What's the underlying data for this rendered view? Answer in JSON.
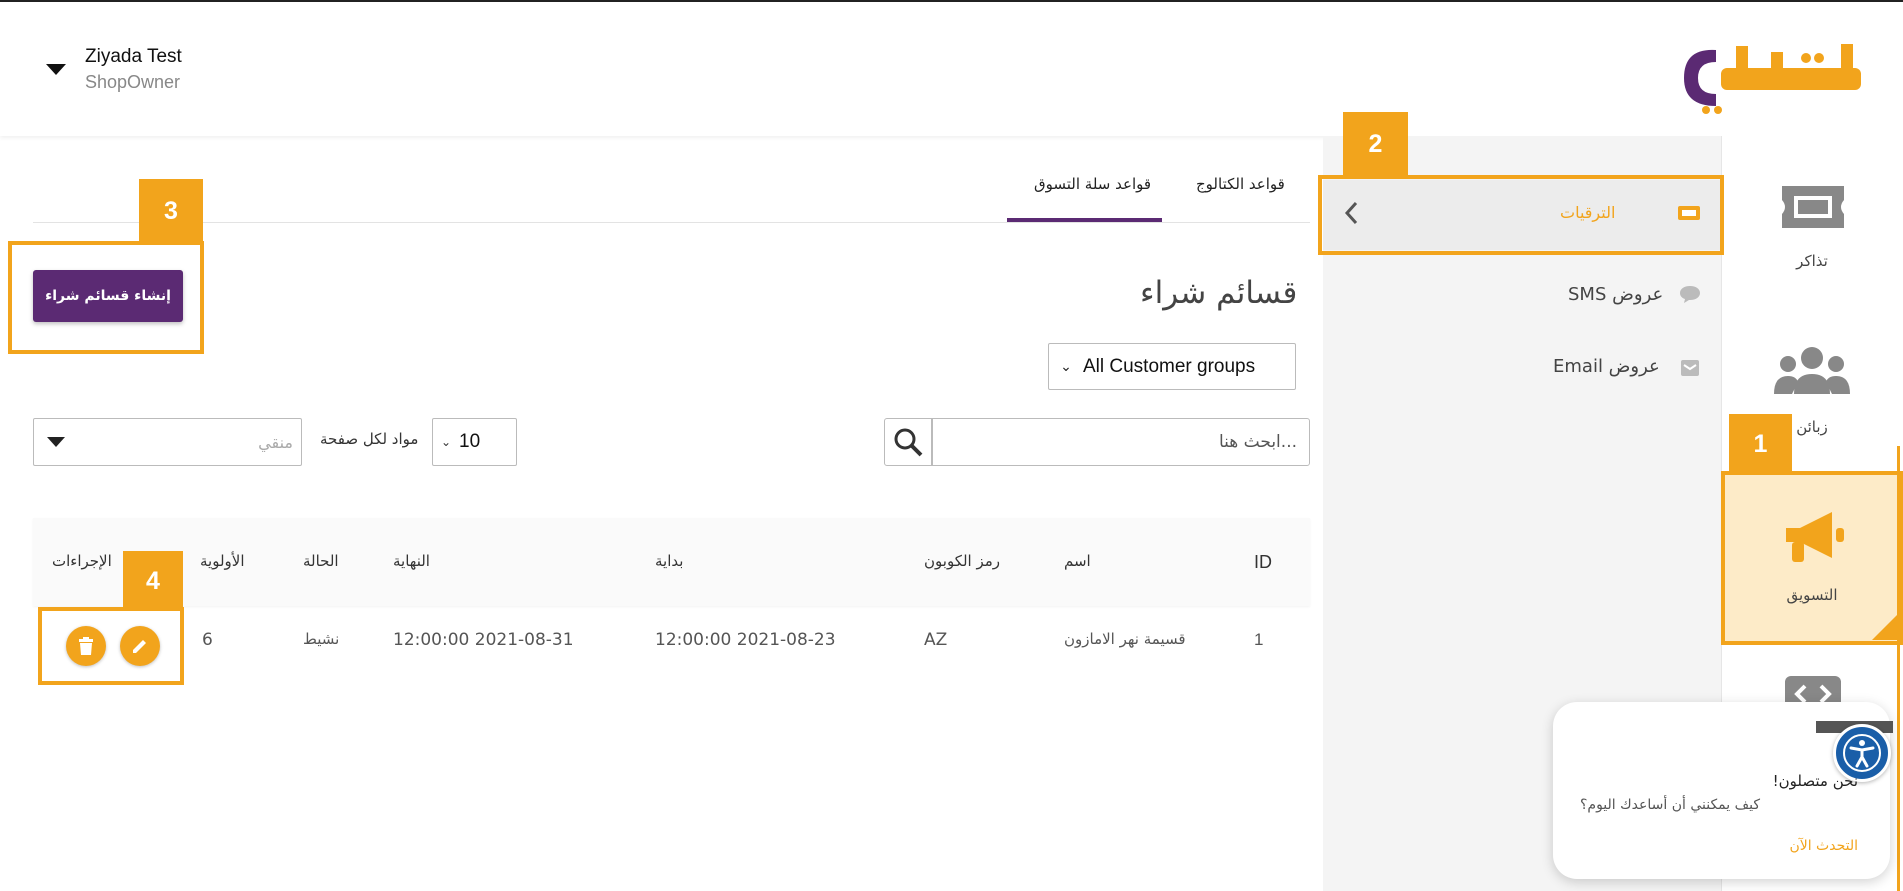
{
  "header": {
    "user_name": "Ziyada Test",
    "user_role": "ShopOwner",
    "logo_text": "كليفا"
  },
  "rail": {
    "items": [
      {
        "label": "تذاكر",
        "icon": "ticket-icon"
      },
      {
        "label": "زبائن",
        "icon": "users-icon"
      },
      {
        "label": "التسويق",
        "icon": "megaphone-icon",
        "active": true
      },
      {
        "label": "",
        "icon": "code-icon"
      }
    ]
  },
  "sidebar": {
    "items": [
      {
        "label": "الترقيات",
        "icon": "ticket-small-icon",
        "active": true
      },
      {
        "label": "عروض SMS",
        "icon": "chat-icon"
      },
      {
        "label": "عروض Email",
        "icon": "email-icon"
      }
    ]
  },
  "annotations": {
    "tag1": "1",
    "tag2": "2",
    "tag3": "3",
    "tag4": "4"
  },
  "tabs": [
    {
      "label": "قواعد الكتالوج"
    },
    {
      "label": "قواعد سلة التسوق",
      "active": true
    }
  ],
  "main": {
    "title": "قسائم شراء",
    "create_button": "إنشاء قسائم شراء",
    "customer_group": "All Customer groups",
    "search_placeholder": "...ابحث هنا",
    "per_page_value": "10",
    "per_page_label": "مواد لكل صفحة",
    "filter_placeholder": "منقي"
  },
  "table": {
    "headers": {
      "id": "ID",
      "name": "اسم",
      "coupon": "رمز الكوبون",
      "start": "بداية",
      "end": "النهاية",
      "status": "الحالة",
      "priority": "الأولوية",
      "actions": "الإجراءات"
    },
    "rows": [
      {
        "id": "1",
        "name": "قسيمة نهر الامازون",
        "coupon": "AZ",
        "start": "2021-08-23 12:00:00",
        "end": "2021-08-31 12:00:00",
        "status": "نشيط",
        "priority": "6"
      }
    ]
  },
  "chat": {
    "title": "نحن متصلون!",
    "subtitle": "كيف يمكنني أن أساعدك اليوم؟",
    "link": "التحدث الآن"
  },
  "colors": {
    "accent": "#f2a41c",
    "primary": "#5b2a73",
    "panel": "#f4f4f4"
  }
}
